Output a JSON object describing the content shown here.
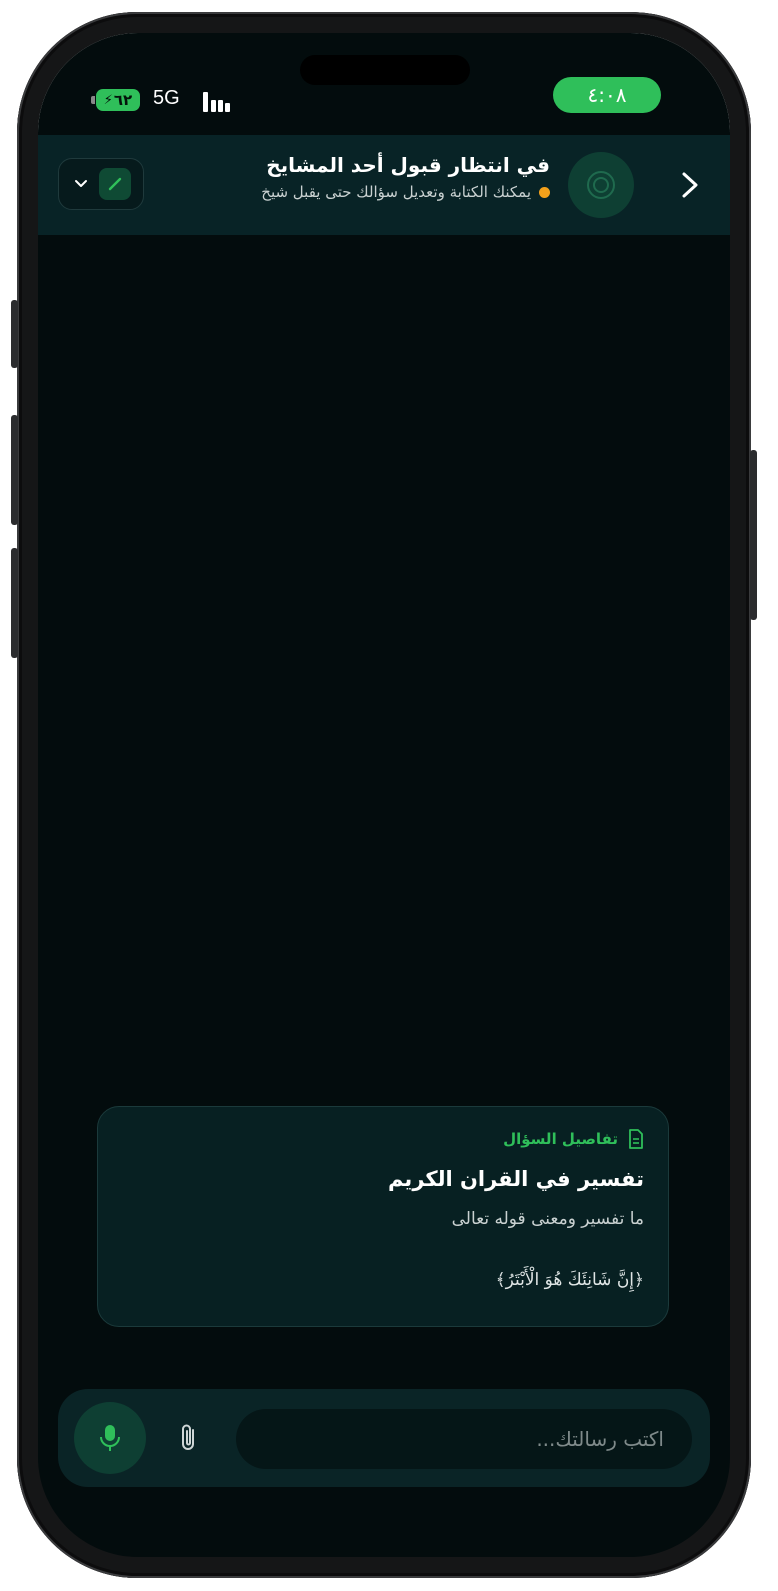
{
  "status_bar": {
    "time": "٤:٠٨",
    "battery": "٦٢",
    "network": "5G"
  },
  "header": {
    "title": "في انتظار قبول أحد المشايخ",
    "subtitle": "يمكنك الكتابة وتعديل سؤالك حتى يقبل شيخ",
    "status_color": "#f3a11b"
  },
  "question_card": {
    "heading": "تفاصيل السؤال",
    "title": "تفسير في القران الكريم",
    "body": "ما تفسير ومعنى قوله تعالى",
    "verse": "﴿إِنَّ شَانِئَكَ هُوَ الْأَبْتَرُ﴾"
  },
  "composer": {
    "placeholder": "اكتب رسالتك...",
    "value": ""
  },
  "colors": {
    "accent": "#2fbf5a",
    "background": "#030c0d",
    "header_bg": "#082326"
  },
  "icons": [
    "back-arrow-icon",
    "avatar-logo-icon",
    "pen-icon",
    "chevron-down-icon",
    "document-icon",
    "microphone-icon",
    "paperclip-icon"
  ]
}
